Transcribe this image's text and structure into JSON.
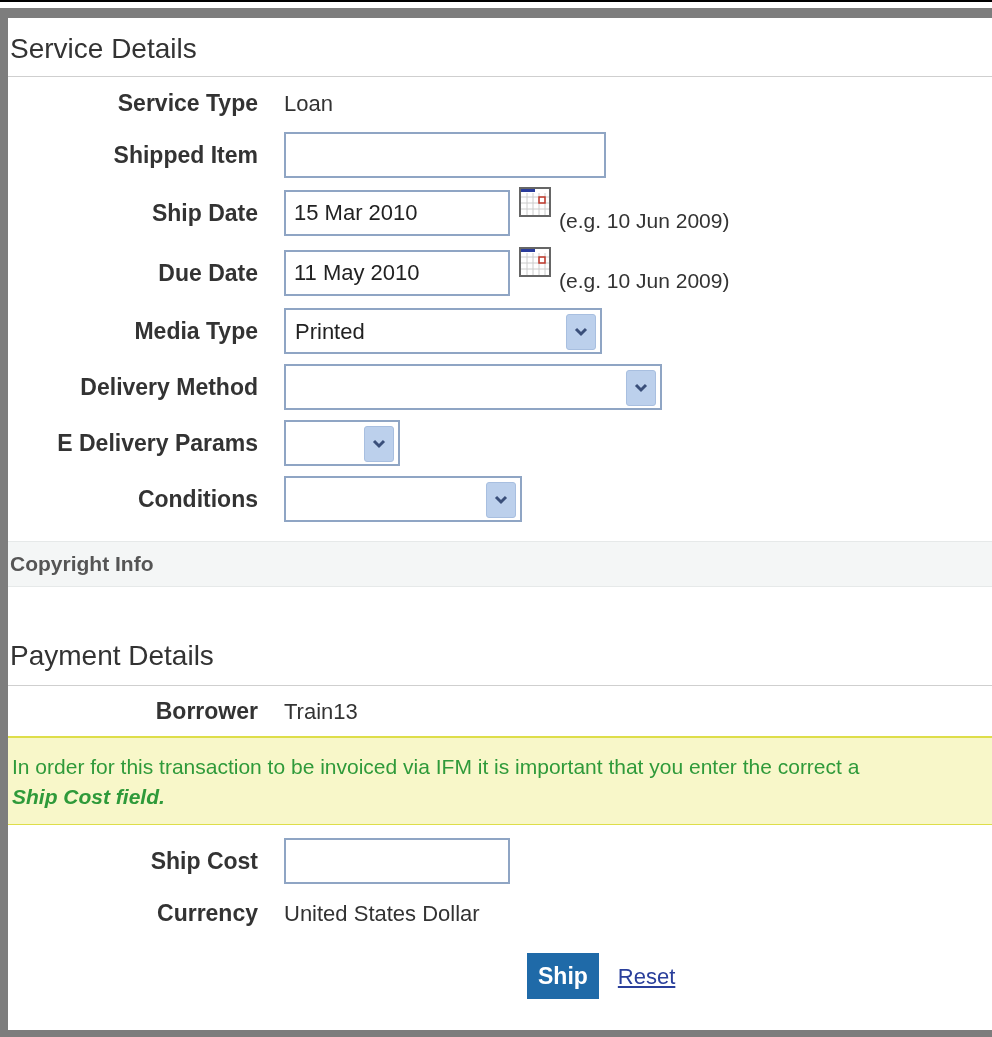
{
  "service_details": {
    "title": "Service Details",
    "fields": [
      {
        "kind": "text",
        "label": "Service Type",
        "value": "Loan"
      },
      {
        "kind": "input",
        "label": "Shipped Item"
      },
      {
        "kind": "date",
        "label": "Ship Date",
        "value": "15 Mar 2010",
        "hint": "(e.g. 10 Jun 2009)"
      },
      {
        "kind": "date",
        "label": "Due Date",
        "value": "11 May 2010",
        "hint": "(e.g. 10 Jun 2009)"
      },
      {
        "kind": "select",
        "label": "Media Type",
        "value": "Printed"
      },
      {
        "kind": "select",
        "label": "Delivery Method"
      },
      {
        "kind": "select",
        "label": "E Delivery Params"
      },
      {
        "kind": "select",
        "label": "Conditions"
      }
    ]
  },
  "copyright": {
    "title": "Copyright Info"
  },
  "payment_details": {
    "title": "Payment Details",
    "borrower": {
      "label": "Borrower",
      "value": "Train13"
    },
    "notice": {
      "text": "In order for this transaction to be invoiced via IFM it is important that you enter the correct a",
      "emphasis": "Ship Cost field."
    },
    "fields": [
      {
        "kind": "input",
        "label": "Ship Cost"
      },
      {
        "kind": "text",
        "label": "Currency",
        "value": "United States Dollar"
      }
    ]
  },
  "actions": {
    "primary": "Ship",
    "link": "Reset"
  }
}
